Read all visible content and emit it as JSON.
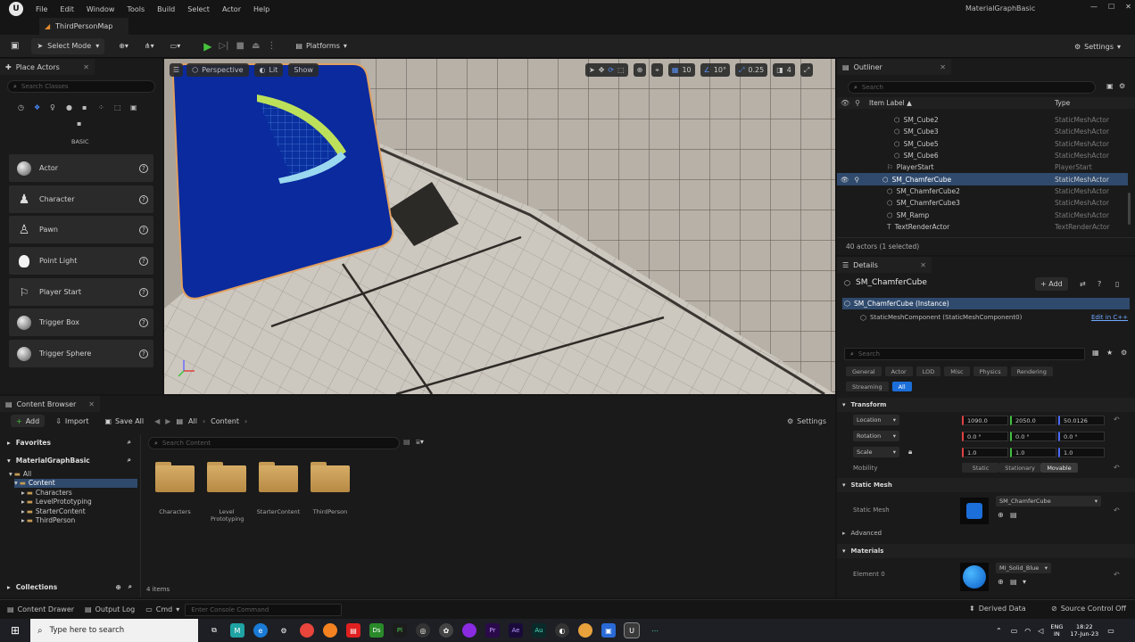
{
  "menu": [
    "File",
    "Edit",
    "Window",
    "Tools",
    "Build",
    "Select",
    "Actor",
    "Help"
  ],
  "project_name": "MaterialGraphBasic",
  "map_tab": "ThirdPersonMap",
  "toolbar": {
    "select_mode": "Select Mode",
    "platforms": "Platforms",
    "settings": "Settings"
  },
  "place_actors": {
    "tab": "Place Actors",
    "search_placeholder": "Search Classes",
    "category": "BASIC",
    "items": [
      "Actor",
      "Character",
      "Pawn",
      "Point Light",
      "Player Start",
      "Trigger Box",
      "Trigger Sphere"
    ]
  },
  "viewport": {
    "perspective": "Perspective",
    "lit": "Lit",
    "show": "Show",
    "grid": "10",
    "angle": "10°",
    "scale": "0.25",
    "camera_speed": "4"
  },
  "outliner": {
    "tab": "Outliner",
    "search_placeholder": "Search",
    "col_label": "Item Label ▲",
    "col_type": "Type",
    "rows": [
      {
        "label": "SM_Cube2",
        "type": "StaticMeshActor"
      },
      {
        "label": "SM_Cube3",
        "type": "StaticMeshActor"
      },
      {
        "label": "SM_Cube5",
        "type": "StaticMeshActor"
      },
      {
        "label": "SM_Cube6",
        "type": "StaticMeshActor"
      },
      {
        "label": "PlayerStart",
        "type": "PlayerStart"
      },
      {
        "label": "SM_ChamferCube",
        "type": "StaticMeshActor"
      },
      {
        "label": "SM_ChamferCube2",
        "type": "StaticMeshActor"
      },
      {
        "label": "SM_ChamferCube3",
        "type": "StaticMeshActor"
      },
      {
        "label": "SM_Ramp",
        "type": "StaticMeshActor"
      },
      {
        "label": "TextRenderActor",
        "type": "TextRenderActor"
      }
    ],
    "count": "40 actors (1 selected)"
  },
  "details": {
    "tab": "Details",
    "actor_name": "SM_ChamferCube",
    "add": "+ Add",
    "instance": "SM_ChamferCube (Instance)",
    "component": "StaticMeshComponent (StaticMeshComponent0)",
    "edit_cpp": "Edit in C++",
    "search_placeholder": "Search",
    "filters": [
      "General",
      "Actor",
      "LOD",
      "Misc",
      "Physics",
      "Rendering"
    ],
    "filters2": [
      "Streaming",
      "All"
    ],
    "transform": "Transform",
    "location_label": "Location",
    "location": [
      "1090.0",
      "2050.0",
      "50.0126"
    ],
    "rotation_label": "Rotation",
    "rotation": [
      "0.0 °",
      "0.0 °",
      "0.0 °"
    ],
    "scale_label": "Scale",
    "scale": [
      "1.0",
      "1.0",
      "1.0"
    ],
    "mobility_label": "Mobility",
    "mobility": [
      "Static",
      "Stationary",
      "Movable"
    ],
    "static_mesh_section": "Static Mesh",
    "static_mesh_label": "Static Mesh",
    "static_mesh_value": "SM_ChamferCube",
    "advanced": "Advanced",
    "materials_section": "Materials",
    "element0_label": "Element 0",
    "element0_value": "MI_Solid_Blue"
  },
  "content_browser": {
    "tab": "Content Browser",
    "add": "Add",
    "import": "Import",
    "save_all": "Save All",
    "breadcrumb_all": "All",
    "breadcrumb_content": "Content",
    "settings": "Settings",
    "favorites": "Favorites",
    "project": "MaterialGraphBasic",
    "tree": [
      "All",
      "Content",
      "Characters",
      "LevelPrototyping",
      "StarterContent",
      "ThirdPerson"
    ],
    "search_placeholder": "Search Content",
    "folders": [
      "Characters",
      "Level Prototyping",
      "StarterContent",
      "ThirdPerson"
    ],
    "collections": "Collections",
    "items_count": "4 items"
  },
  "status": {
    "content_drawer": "Content Drawer",
    "output_log": "Output Log",
    "cmd": "Cmd",
    "console_placeholder": "Enter Console Command",
    "derived_data": "Derived Data",
    "source_control": "Source Control Off"
  },
  "taskbar": {
    "search_placeholder": "Type here to search",
    "lang": "ENG",
    "region": "IN",
    "time": "18:22",
    "date": "17-Jun-23"
  }
}
